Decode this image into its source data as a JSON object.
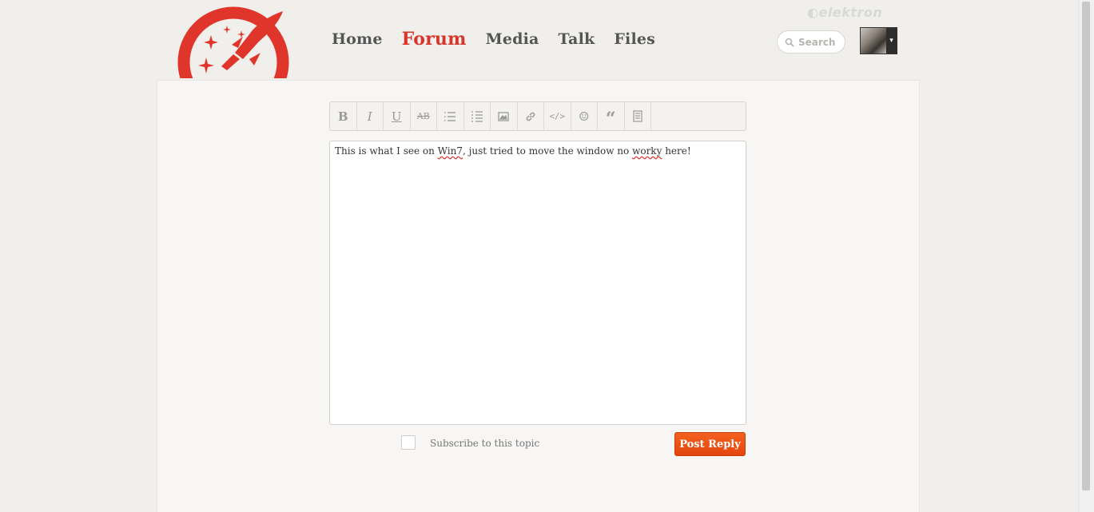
{
  "brand": "elektron",
  "nav": {
    "items": [
      {
        "label": "Home",
        "active": false
      },
      {
        "label": "Forum",
        "active": true
      },
      {
        "label": "Media",
        "active": false
      },
      {
        "label": "Talk",
        "active": false
      },
      {
        "label": "Files",
        "active": false
      }
    ]
  },
  "search": {
    "placeholder": "Search",
    "icon": "search-icon"
  },
  "user_menu": {
    "caret": "▾"
  },
  "toolbar": {
    "buttons": [
      {
        "name": "bold-icon",
        "glyph": "B"
      },
      {
        "name": "italic-icon",
        "glyph": "I"
      },
      {
        "name": "underline-icon",
        "glyph": "U"
      },
      {
        "name": "strikethrough-icon",
        "glyph": "AB"
      },
      {
        "name": "bulleted-list-icon"
      },
      {
        "name": "numbered-list-icon"
      },
      {
        "name": "image-icon"
      },
      {
        "name": "link-icon"
      },
      {
        "name": "code-icon",
        "glyph": "</>"
      },
      {
        "name": "emoji-icon",
        "glyph": "☺"
      },
      {
        "name": "quote-icon",
        "glyph": "“"
      },
      {
        "name": "document-icon"
      }
    ]
  },
  "editor": {
    "text_before": "This is what I see on ",
    "misspelled_1": "Win7",
    "text_middle": ", just tried to move the window no ",
    "misspelled_2": "worky",
    "text_after": " here!"
  },
  "subscribe": {
    "label": "Subscribe to this topic",
    "checked": false
  },
  "post_button": {
    "label": "Post Reply"
  },
  "colors": {
    "accent": "#d8352a",
    "button": "#f05a1a"
  }
}
